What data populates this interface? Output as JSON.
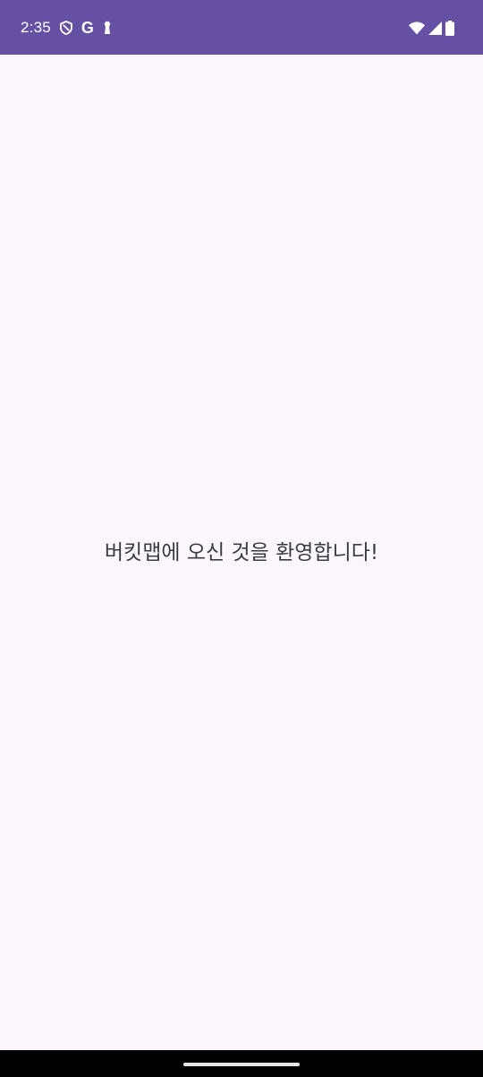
{
  "status_bar": {
    "time": "2:35",
    "background_color": "#6650A4",
    "left_icons": [
      "shield-icon",
      "google-icon",
      "keyhole-icon"
    ],
    "google_glyph": "G",
    "right_icons": [
      "wifi-icon",
      "cellular-signal-icon",
      "battery-icon"
    ]
  },
  "main": {
    "welcome_text": "버킷맵에 오신 것을 환영합니다!",
    "background_color": "#FCF7FD"
  },
  "nav_bar": {
    "background_color": "#000000"
  }
}
